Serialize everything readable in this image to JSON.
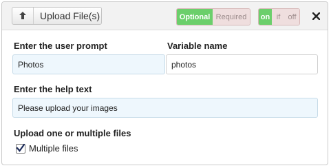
{
  "header": {
    "type_button_label": "Upload File(s)",
    "type_icon": "upload-arrow-icon",
    "requirement": {
      "options": [
        "Optional",
        "Required"
      ],
      "selected": "Optional"
    },
    "condition": {
      "options": [
        "on",
        "if",
        "off"
      ],
      "selected": "on"
    },
    "close_icon": "close-icon",
    "active_color": "#6bcf6b"
  },
  "form": {
    "prompt_label": "Enter the user prompt",
    "prompt_value": "Photos",
    "variable_label": "Variable name",
    "variable_value": "photos",
    "help_label": "Enter the help text",
    "help_value": "Please upload your images",
    "multiple_label": "Upload one or multiple files",
    "multiple_checkbox_label": "Multiple files",
    "multiple_checked": true
  }
}
